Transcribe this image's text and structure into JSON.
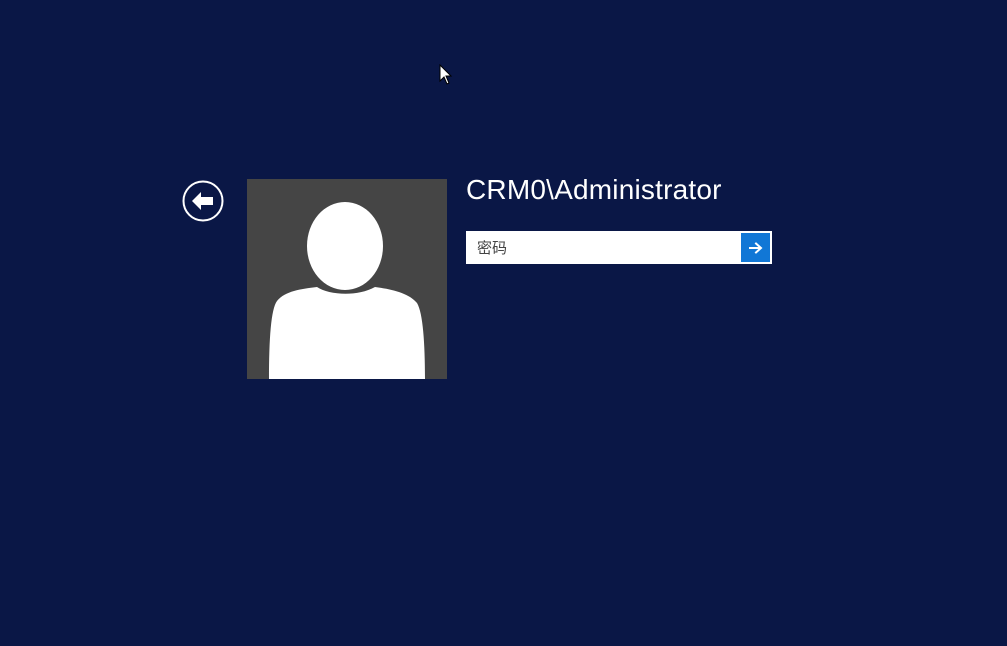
{
  "login": {
    "user_name": "CRM0\\Administrator",
    "password": {
      "placeholder": "密码",
      "value": ""
    }
  },
  "icons": {
    "back": "back-arrow-circle-icon",
    "submit": "arrow-right-icon",
    "avatar": "user-silhouette-icon",
    "pointer": "mouse-pointer-icon"
  },
  "colors": {
    "background": "#0a1746",
    "avatar_bg": "#454545",
    "submit_button": "#1177d6",
    "text": "#ffffff"
  }
}
